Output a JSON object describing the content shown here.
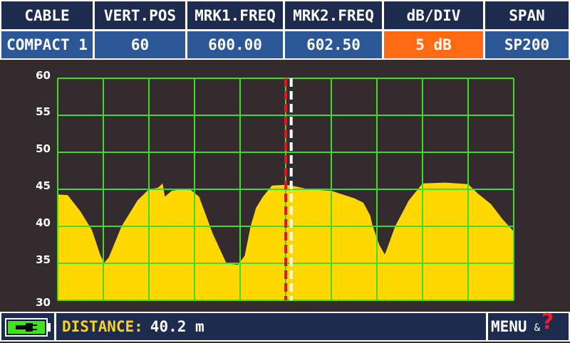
{
  "header": {
    "columns": [
      {
        "label": "CABLE",
        "value": "COMPACT 1"
      },
      {
        "label": "VERT.POS",
        "value": "60"
      },
      {
        "label": "MRK1.FREQ",
        "value": "600.00"
      },
      {
        "label": "MRK2.FREQ",
        "value": "602.50"
      },
      {
        "label": "dB/DIV",
        "value": "5 dB"
      },
      {
        "label": "SPAN",
        "value": "SP200"
      }
    ]
  },
  "colors": {
    "header_label_bg": "#1c2b4e",
    "header_value_bg": "#2c5797",
    "active_value_bg": "#ff6a12",
    "plot_background": "#332b2d",
    "grid": "#3cdc28",
    "trace_fill": "#ffd800",
    "marker1": "#e3141b",
    "marker2": "#ffffff"
  },
  "chart_data": {
    "type": "area",
    "y_tick_labels": [
      "60",
      "55",
      "50",
      "45",
      "40",
      "35",
      "30"
    ],
    "ylim": [
      30,
      60
    ],
    "x_divisions": 10,
    "grid": true,
    "x_relative_range": [
      0,
      1
    ],
    "markers": [
      {
        "name": "MRK1",
        "x_rel": 0.5,
        "style": "dashed-red"
      },
      {
        "name": "MRK2",
        "x_rel": 0.512,
        "style": "dashed-white"
      }
    ],
    "series": [
      {
        "x_rel": [
          0,
          0.022,
          0.05,
          0.075,
          0.094,
          0.102,
          0.112,
          0.14,
          0.175,
          0.2,
          0.22,
          0.23,
          0.235,
          0.25,
          0.27,
          0.29,
          0.31,
          0.34,
          0.37,
          0.395,
          0.41,
          0.423,
          0.435,
          0.45,
          0.47,
          0.5,
          0.52,
          0.55,
          0.6,
          0.65,
          0.67,
          0.685,
          0.69,
          0.705,
          0.717,
          0.72,
          0.74,
          0.77,
          0.8,
          0.85,
          0.9,
          0.92,
          0.95,
          0.975,
          1.0
        ],
        "values": [
          44.3,
          44.2,
          42,
          39.5,
          36,
          35.1,
          35.8,
          40,
          43.5,
          45,
          45.2,
          45.8,
          44,
          44.8,
          45,
          45,
          44,
          39,
          35,
          34.8,
          36,
          40,
          42.5,
          44,
          45.5,
          45.6,
          45.4,
          45,
          44.8,
          43.8,
          43.2,
          41.5,
          40.2,
          37.5,
          36.2,
          36.6,
          40,
          43.5,
          45.8,
          45.9,
          45.7,
          44.5,
          43,
          41,
          39.3
        ]
      }
    ]
  },
  "footer": {
    "battery_icon": "battery-plug-icon",
    "distance_label": "DISTANCE:",
    "distance_value": "40.2 m",
    "menu_label": "MENU",
    "menu_amp": "&",
    "help_mark": "?"
  }
}
